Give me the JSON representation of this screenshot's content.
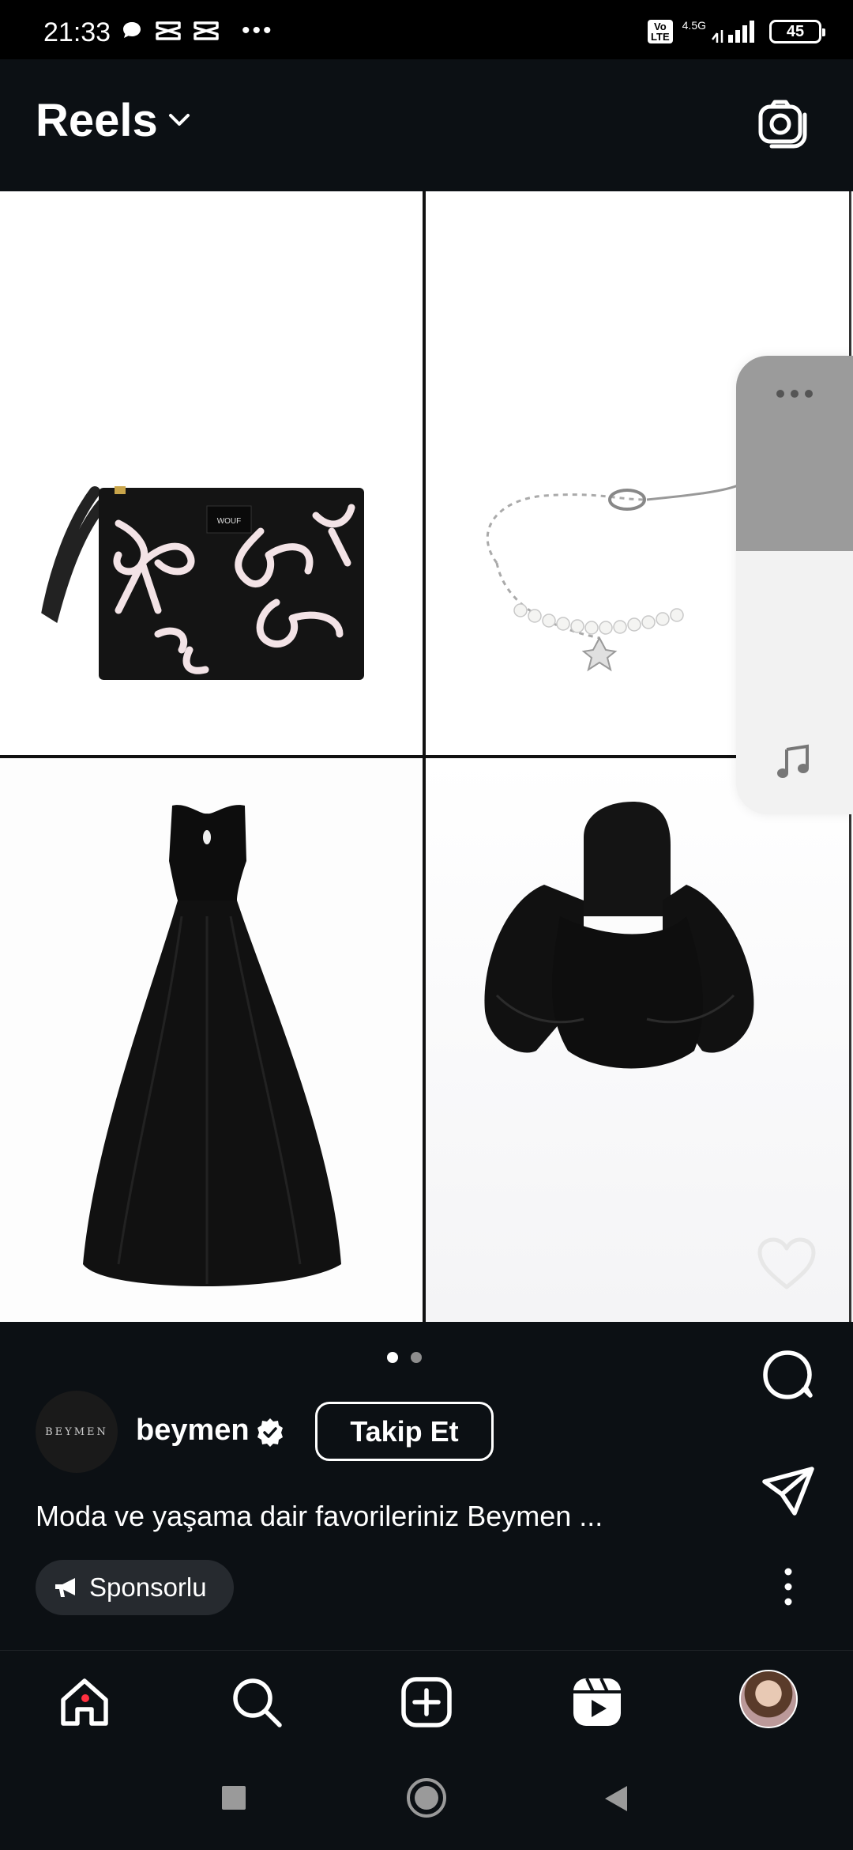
{
  "status_bar": {
    "time": "21:33",
    "volte": "Vo\nLTE",
    "network": "4.5G",
    "battery": "45"
  },
  "header": {
    "title": "Reels"
  },
  "reel": {
    "carousel_total": 2,
    "carousel_active": 1,
    "brand_label_on_bag": "WOUF",
    "account": {
      "avatar_text": "BEYMEN",
      "username": "beymen",
      "verified": true,
      "follow_label": "Takip Et"
    },
    "caption": "Moda ve yaşama dair favorileriniz Beymen ...",
    "sponsored_label": "Sponsorlu"
  },
  "colors": {
    "background": "#0c1014",
    "text": "#ffffff",
    "notification_dot": "#ff3040",
    "panel_grey": "#9b9b9b"
  },
  "icons": {
    "header": [
      "chevron-down-icon",
      "camera-icon"
    ],
    "actions": [
      "heart-icon",
      "comment-icon",
      "share-icon",
      "more-vertical-icon"
    ],
    "nav": [
      "home-icon",
      "search-icon",
      "create-icon",
      "reels-icon",
      "profile-avatar"
    ],
    "system": [
      "recent-apps-icon",
      "home-circle-icon",
      "back-icon"
    ]
  }
}
